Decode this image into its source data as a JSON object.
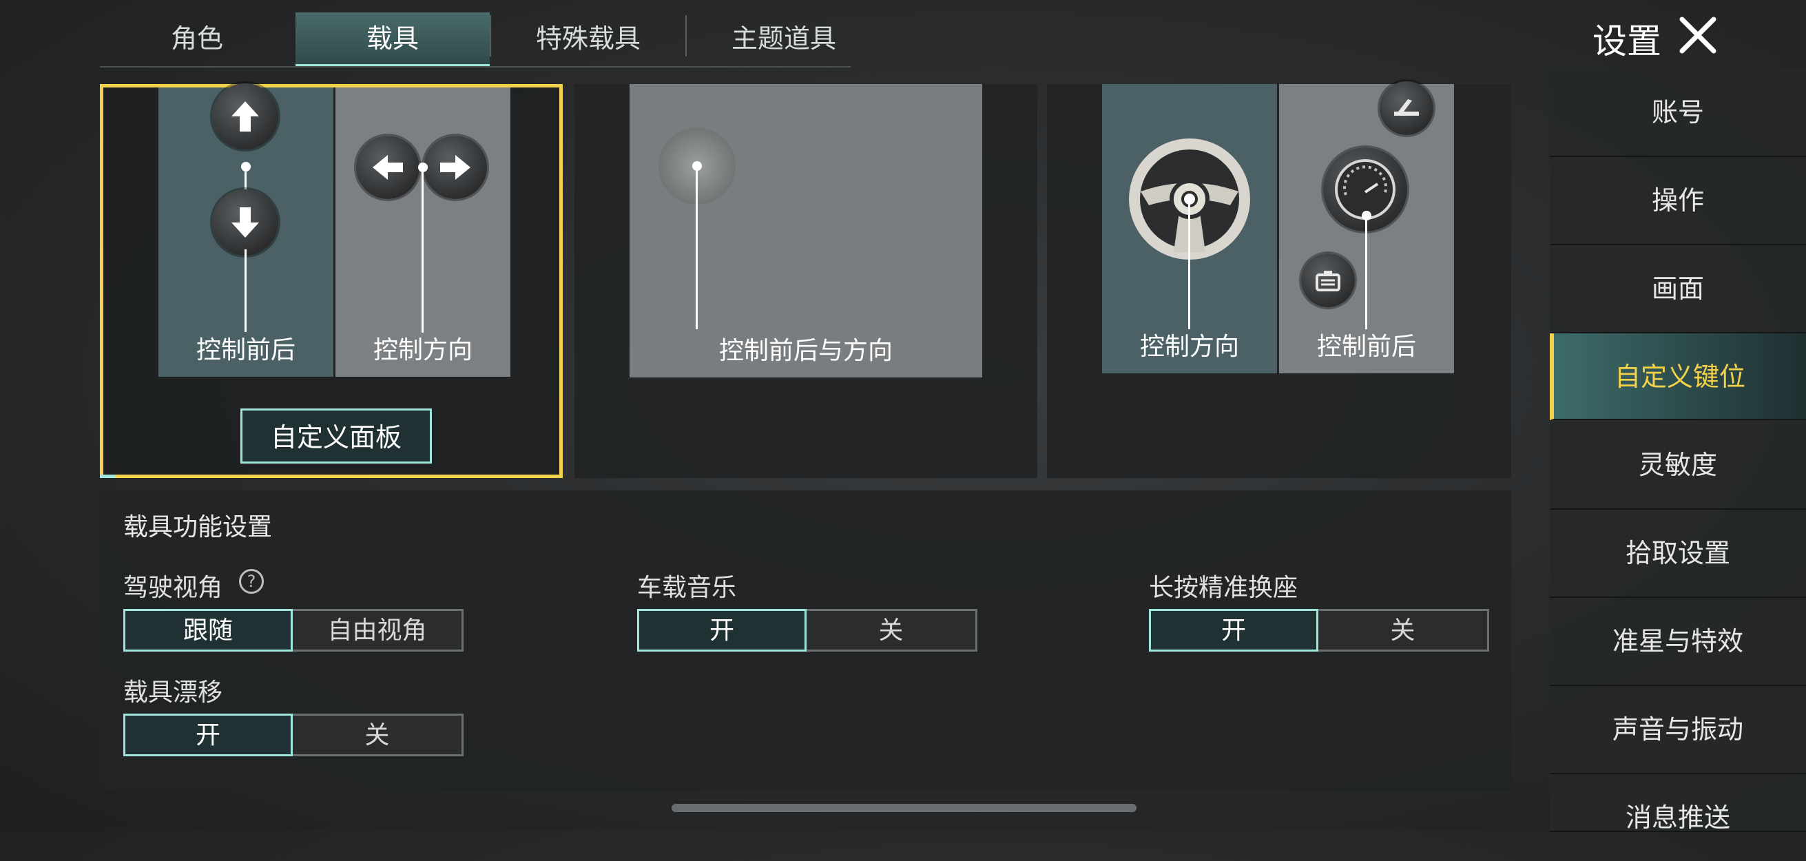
{
  "tabs": [
    "角色",
    "载具",
    "特殊载具",
    "主题道具"
  ],
  "active_tab": 1,
  "header": {
    "title": "设置"
  },
  "sidebar": {
    "items": [
      {
        "label": "账号"
      },
      {
        "label": "操作"
      },
      {
        "label": "画面"
      },
      {
        "label": "自定义键位"
      },
      {
        "label": "灵敏度"
      },
      {
        "label": "拾取设置"
      },
      {
        "label": "准星与特效"
      },
      {
        "label": "声音与振动"
      },
      {
        "label": "消息推送"
      }
    ],
    "active_index": 3
  },
  "control_schemes": {
    "scheme1": {
      "left_zone_label": "控制前后",
      "right_zone_label": "控制方向",
      "custom_button": "自定义面板",
      "selected": true
    },
    "scheme2": {
      "zone_label": "控制前后与方向"
    },
    "scheme3": {
      "left_zone_label": "控制方向",
      "right_zone_label": "控制前后"
    }
  },
  "vehicle_settings": {
    "section_title": "载具功能设置",
    "driving_view": {
      "label": "驾驶视角",
      "options": [
        "跟随",
        "自由视角"
      ],
      "selected": 0
    },
    "car_music": {
      "label": "车载音乐",
      "options": [
        "开",
        "关"
      ],
      "selected": 0
    },
    "long_press_seat": {
      "label": "长按精准换座",
      "options": [
        "开",
        "关"
      ],
      "selected": 0
    },
    "vehicle_drift": {
      "label": "载具漂移",
      "options": [
        "开",
        "关"
      ],
      "selected": 0
    }
  },
  "colors": {
    "accent": "#9ee6dc",
    "highlight": "#f2d24a"
  }
}
